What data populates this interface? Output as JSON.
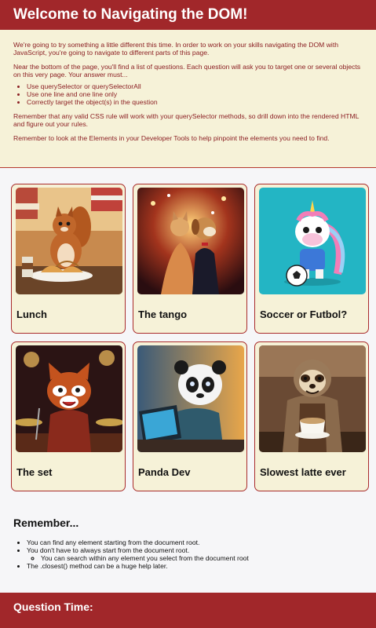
{
  "header": {
    "title": "Welcome to Navigating the DOM!"
  },
  "intro": {
    "p1": "We're going to try something a little different this time. In order to work on your skills navigating the DOM with JavaScript, you're going to navigate to different parts of this page.",
    "p2": "Near the bottom of the page, you'll find a list of questions. Each question will ask you to target one or several objects on this very page. Your answer must...",
    "rules": [
      "Use querySelector or querySelectorAll",
      "Use one line and one line only",
      "Correctly target the object(s) in the question"
    ],
    "p3": "Remember that any valid CSS rule will work with your querySelector methods, so drill down into the rendered HTML and figure out your rules.",
    "p4": "Remember to look at the Elements in your Developer Tools to help pinpoint the elements you need to find."
  },
  "cards": [
    {
      "title": "Lunch",
      "image": "squirrel-eating-croissant"
    },
    {
      "title": "The tango",
      "image": "cat-and-dog-dancing"
    },
    {
      "title": "Soccer or Futbol?",
      "image": "unicorn-with-soccer-ball"
    },
    {
      "title": "The set",
      "image": "red-panda-drummer"
    },
    {
      "title": "Panda Dev",
      "image": "panda-at-laptop"
    },
    {
      "title": "Slowest latte ever",
      "image": "sloth-barista"
    }
  ],
  "remember": {
    "title": "Remember...",
    "items": [
      "You can find any element starting from the document root.",
      "You don't have to always start from the document root.",
      "You can search within any element you select from the document root",
      "The .closest() method can be a huge help later."
    ]
  },
  "bottom": {
    "title": "Question Time:"
  },
  "colors": {
    "accent": "#a1272a",
    "cream": "#f6f2d8",
    "text_red": "#8b1f23"
  }
}
